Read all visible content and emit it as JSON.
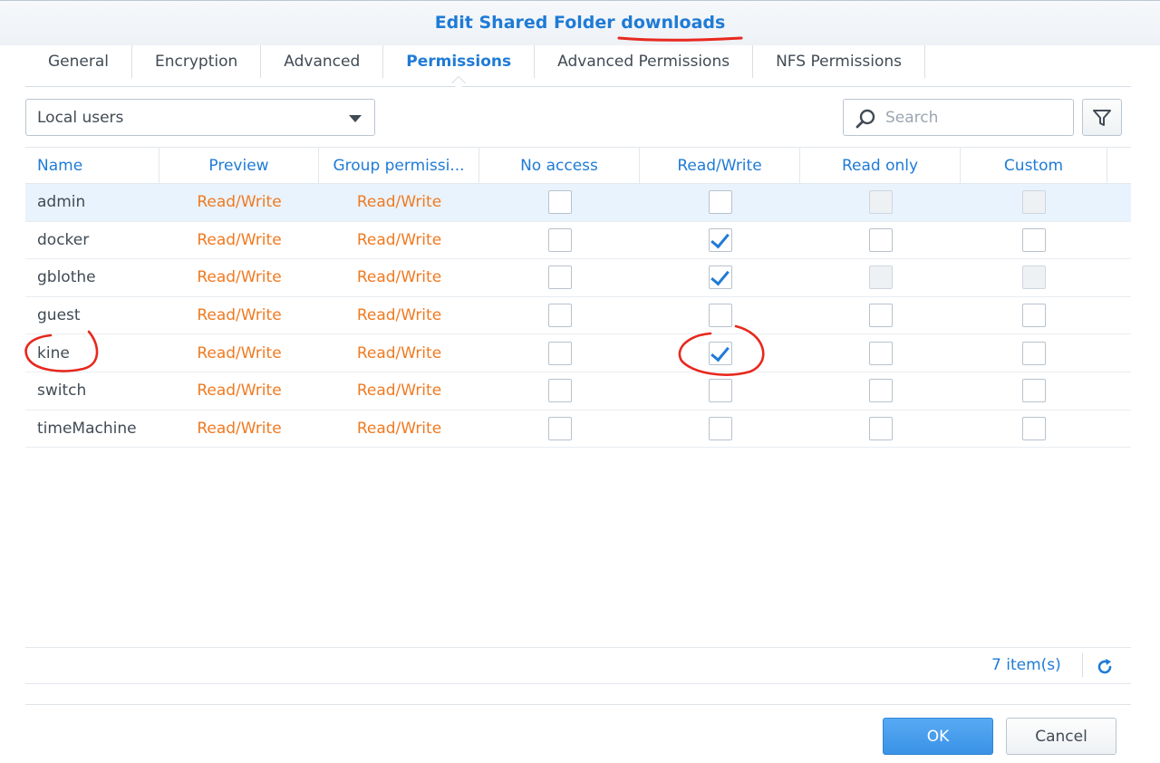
{
  "window": {
    "title_prefix": "Edit Shared Folder",
    "folder_name": "downloads"
  },
  "tabs": [
    {
      "label": "General",
      "active": false
    },
    {
      "label": "Encryption",
      "active": false
    },
    {
      "label": "Advanced",
      "active": false
    },
    {
      "label": "Permissions",
      "active": true
    },
    {
      "label": "Advanced Permissions",
      "active": false
    },
    {
      "label": "NFS Permissions",
      "active": false
    }
  ],
  "toolbar": {
    "user_type_selected": "Local users",
    "search_placeholder": "Search",
    "filter_icon": "filter-icon"
  },
  "grid": {
    "columns": [
      "Name",
      "Preview",
      "Group permissi...",
      "No access",
      "Read/Write",
      "Read only",
      "Custom"
    ],
    "rows": [
      {
        "name": "admin",
        "preview": "Read/Write",
        "group": "Read/Write",
        "no_access": false,
        "read_write": false,
        "read_only": false,
        "custom": false,
        "read_only_disabled": true,
        "custom_disabled": true,
        "selected": true
      },
      {
        "name": "docker",
        "preview": "Read/Write",
        "group": "Read/Write",
        "no_access": false,
        "read_write": true,
        "read_only": false,
        "custom": false,
        "read_only_disabled": false,
        "custom_disabled": false,
        "selected": false
      },
      {
        "name": "gblothe",
        "preview": "Read/Write",
        "group": "Read/Write",
        "no_access": false,
        "read_write": true,
        "read_only": false,
        "custom": false,
        "read_only_disabled": true,
        "custom_disabled": true,
        "selected": false
      },
      {
        "name": "guest",
        "preview": "Read/Write",
        "group": "Read/Write",
        "no_access": false,
        "read_write": false,
        "read_only": false,
        "custom": false,
        "read_only_disabled": false,
        "custom_disabled": false,
        "selected": false
      },
      {
        "name": "kine",
        "preview": "Read/Write",
        "group": "Read/Write",
        "no_access": false,
        "read_write": true,
        "read_only": false,
        "custom": false,
        "read_only_disabled": false,
        "custom_disabled": false,
        "selected": false
      },
      {
        "name": "switch",
        "preview": "Read/Write",
        "group": "Read/Write",
        "no_access": false,
        "read_write": false,
        "read_only": false,
        "custom": false,
        "read_only_disabled": false,
        "custom_disabled": false,
        "selected": false
      },
      {
        "name": "timeMachine",
        "preview": "Read/Write",
        "group": "Read/Write",
        "no_access": false,
        "read_write": false,
        "read_only": false,
        "custom": false,
        "read_only_disabled": false,
        "custom_disabled": false,
        "selected": false
      }
    ]
  },
  "footer": {
    "item_count": "7 item(s)",
    "ok_label": "OK",
    "cancel_label": "Cancel"
  },
  "colors": {
    "accent": "#1f7bd6",
    "permission_text": "#f07a20",
    "annotation": "#e8281e"
  }
}
